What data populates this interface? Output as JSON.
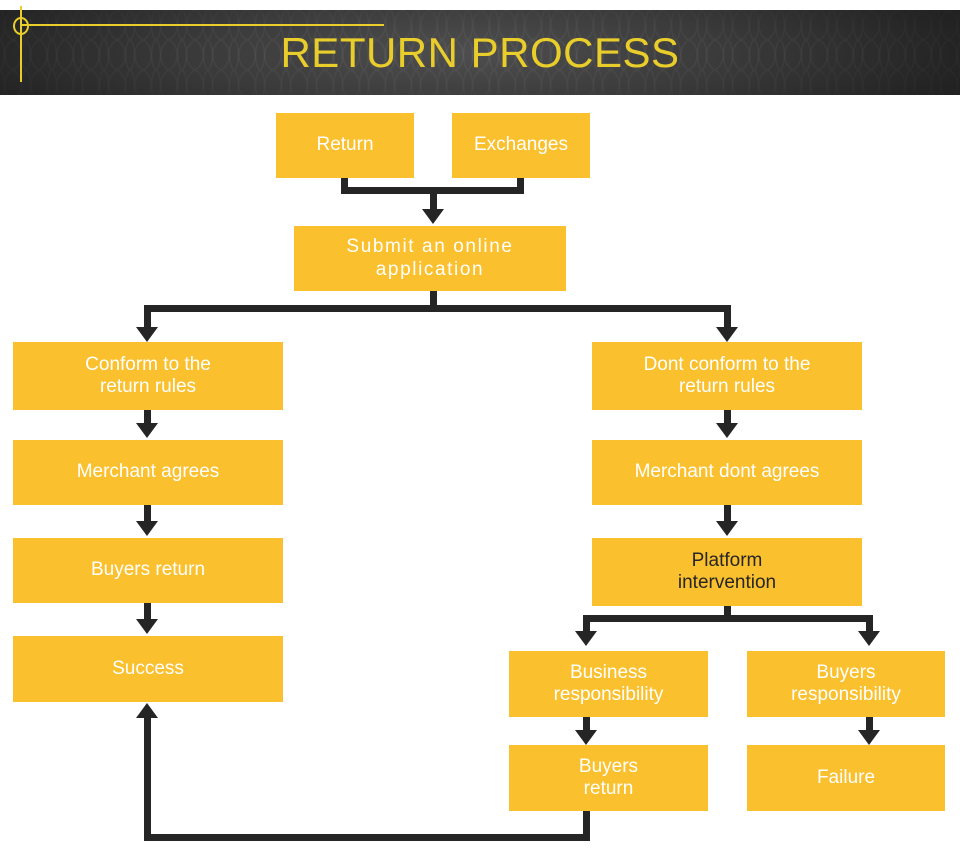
{
  "header": {
    "title": "RETURN PROCESS",
    "title_color": "#E9CE2B",
    "band_color": "#3b3b3b",
    "decor": {
      "circle_icon": "circle-outline-icon",
      "hline": "horizontal-rule",
      "vline": "vertical-rule"
    }
  },
  "theme": {
    "node_fill": "#FBC02D",
    "node_text": "#FFFFFF",
    "node_text_alt": "#262626",
    "connector": "#252525",
    "page_bg": "#FFFFFF"
  },
  "flow": {
    "nodes": [
      {
        "id": "return",
        "label": "Return"
      },
      {
        "id": "exchanges",
        "label": "Exchanges"
      },
      {
        "id": "submit-application",
        "label": "Submit an online application"
      },
      {
        "id": "conform-rules",
        "label": "Conform to the return rules"
      },
      {
        "id": "not-conform-rules",
        "label": "Dont conform to the return rules"
      },
      {
        "id": "merchant-agrees",
        "label": "Merchant agrees"
      },
      {
        "id": "merchant-dont-agrees",
        "label": "Merchant dont agrees"
      },
      {
        "id": "buyers-return-left",
        "label": "Buyers return"
      },
      {
        "id": "platform-intervention",
        "label": "Platform intervention"
      },
      {
        "id": "success",
        "label": "Success"
      },
      {
        "id": "business-responsibility",
        "label": "Business responsibility"
      },
      {
        "id": "buyers-responsibility",
        "label": "Buyers responsibility"
      },
      {
        "id": "buyers-return-right",
        "label": "Buyers return"
      },
      {
        "id": "failure",
        "label": "Failure"
      }
    ],
    "node_labels": {
      "return": "Return",
      "exchanges": "Exchanges",
      "submit_application_line1": "Submit an online",
      "submit_application_line2": "application",
      "conform_line1": "Conform to the",
      "conform_line2": "return rules",
      "not_conform_line1": "Dont conform to the",
      "not_conform_line2": "return rules",
      "merchant_agrees": "Merchant agrees",
      "merchant_dont_agrees": "Merchant dont agrees",
      "buyers_return_left": "Buyers return",
      "platform_line1": "Platform",
      "platform_line2": "intervention",
      "success": "Success",
      "business_resp_line1": "Business",
      "business_resp_line2": "responsibility",
      "buyers_resp_line1": "Buyers",
      "buyers_resp_line2": "responsibility",
      "buyers_return_right_line1": "Buyers",
      "buyers_return_right_line2": "return",
      "failure": "Failure"
    },
    "edges": [
      {
        "from": "return",
        "to": "submit-application"
      },
      {
        "from": "exchanges",
        "to": "submit-application"
      },
      {
        "from": "submit-application",
        "to": "conform-rules"
      },
      {
        "from": "submit-application",
        "to": "not-conform-rules"
      },
      {
        "from": "conform-rules",
        "to": "merchant-agrees"
      },
      {
        "from": "merchant-agrees",
        "to": "buyers-return-left"
      },
      {
        "from": "buyers-return-left",
        "to": "success"
      },
      {
        "from": "not-conform-rules",
        "to": "merchant-dont-agrees"
      },
      {
        "from": "merchant-dont-agrees",
        "to": "platform-intervention"
      },
      {
        "from": "platform-intervention",
        "to": "business-responsibility"
      },
      {
        "from": "platform-intervention",
        "to": "buyers-responsibility"
      },
      {
        "from": "business-responsibility",
        "to": "buyers-return-right"
      },
      {
        "from": "buyers-responsibility",
        "to": "failure"
      },
      {
        "from": "buyers-return-right",
        "to": "success"
      }
    ]
  }
}
